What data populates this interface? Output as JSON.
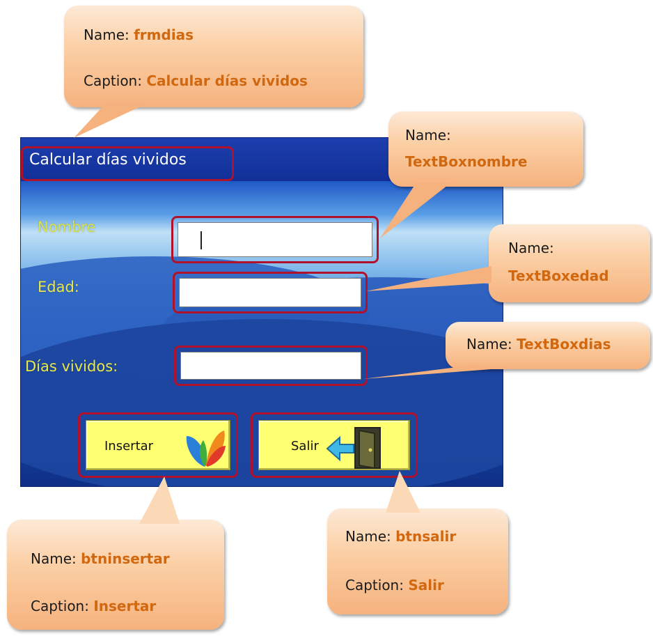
{
  "form": {
    "caption": "Calcular días vividos",
    "labels": {
      "nombre": "Nombre",
      "edad": "Edad:",
      "dias": "Días vividos:"
    },
    "fields": {
      "nombre": "",
      "edad": "",
      "dias": ""
    },
    "buttons": {
      "insertar": "Insertar",
      "salir": "Salir"
    }
  },
  "callouts": {
    "form": {
      "name_label": "Name:",
      "name_value": "frmdias",
      "caption_label": "Caption:",
      "caption_value": "Calcular días vividos"
    },
    "nombre": {
      "name_label": "Name:",
      "name_value": "TextBoxnombre"
    },
    "edad": {
      "name_label": "Name:",
      "name_value": "TextBoxedad"
    },
    "dias": {
      "name_label": "Name:",
      "name_value": "TextBoxdias"
    },
    "insertar": {
      "name_label": "Name:",
      "name_value": "btninsertar",
      "caption_label": "Caption:",
      "caption_value": "Insertar"
    },
    "salir": {
      "name_label": "Name:",
      "name_value": "btnsalir",
      "caption_label": "Caption:",
      "caption_value": "Salir"
    }
  },
  "colors": {
    "highlight": "#d1680f",
    "frame_red": "#b0122b",
    "button_yellow": "#ffff72",
    "label_yellow": "#e9e94a",
    "title_bar": "#122f97"
  },
  "icons": {
    "insertar_button": "msn-butterfly-icon",
    "salir_button": "exit-door-icon"
  }
}
